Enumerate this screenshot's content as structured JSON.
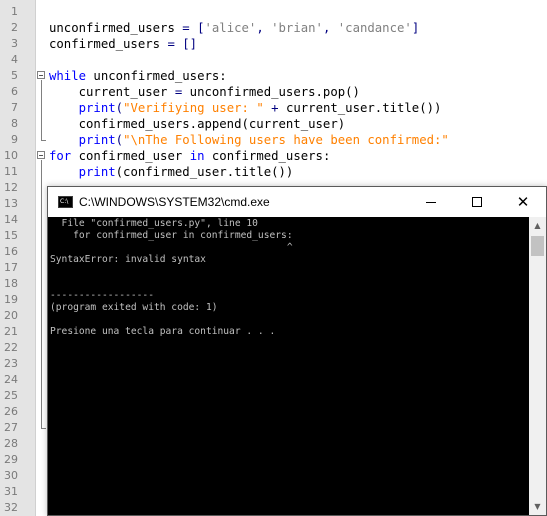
{
  "editor": {
    "line_numbers": [
      "1",
      "2",
      "3",
      "4",
      "5",
      "6",
      "7",
      "8",
      "9",
      "10",
      "11",
      "12",
      "13",
      "14",
      "15",
      "16",
      "17",
      "18",
      "19",
      "20",
      "21",
      "22",
      "23",
      "24",
      "25",
      "26",
      "27",
      "28",
      "29",
      "30",
      "31",
      "32"
    ],
    "code": {
      "l2": {
        "a": "unconfirmed_users ",
        "b": "=",
        "c": " [",
        "d": "'alice'",
        "e": ", ",
        "f": "'brian'",
        "g": ", ",
        "h": "'candance'",
        "i": "]"
      },
      "l3": {
        "a": "confirmed_users ",
        "b": "=",
        "c": " []"
      },
      "l5": {
        "kw": "while",
        "rest": " unconfirmed_users:"
      },
      "l6": {
        "a": "    current_user ",
        "b": "=",
        "c": " unconfirmed_users.pop()"
      },
      "l7": {
        "indent": "    ",
        "kw": "print",
        "a": "(",
        "s": "\"Verifiying user: \"",
        "b": " ",
        "op": "+",
        "c": " current_user.title())"
      },
      "l8": {
        "a": "    confirmed_users.append(current_user)"
      },
      "l9": {
        "indent": "    ",
        "kw": "print",
        "a": "(",
        "s": "\"\\nThe Following users have been confirmed:\""
      },
      "l10": {
        "kw": "for",
        "a": " confirmed_user ",
        "kw2": "in",
        "b": " confirmed_users:"
      },
      "l11": {
        "indent": "    ",
        "kw": "print",
        "a": "(confirmed_user.title())"
      }
    }
  },
  "cmd": {
    "title": "C:\\WINDOWS\\SYSTEM32\\cmd.exe",
    "icon_label": "C:\\",
    "close_glyph": "✕",
    "scroll_up_glyph": "▲",
    "scroll_down_glyph": "▼",
    "output": [
      "  File \"confirmed_users.py\", line 10",
      "    for confirmed_user in confirmed_users:",
      "                                         ^",
      "SyntaxError: invalid syntax",
      "",
      "",
      "------------------",
      "(program exited with code: 1)",
      "",
      "Presione una tecla para continuar . . ."
    ]
  }
}
